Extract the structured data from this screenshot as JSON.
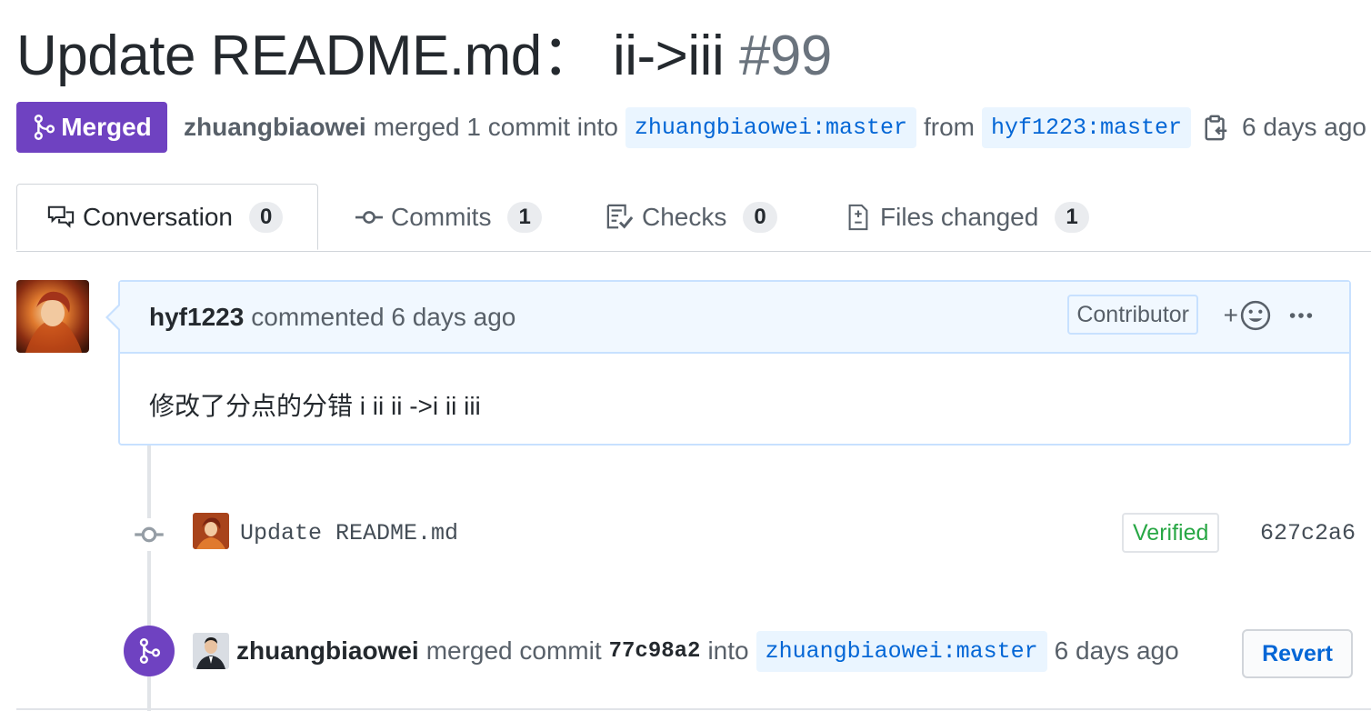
{
  "pr": {
    "title": "Update README.md： ii->iii",
    "number": "#99",
    "state": "Merged",
    "merger": "zhuangbiaowei",
    "merged_text": "merged 1 commit into",
    "base_ref": "zhuangbiaowei:master",
    "from_text": "from",
    "head_ref": "hyf1223:master",
    "time": "6 days ago"
  },
  "tabs": [
    {
      "label": "Conversation",
      "count": "0",
      "icon": "comment-discussion-icon"
    },
    {
      "label": "Commits",
      "count": "1",
      "icon": "git-commit-icon"
    },
    {
      "label": "Checks",
      "count": "0",
      "icon": "checklist-icon"
    },
    {
      "label": "Files changed",
      "count": "1",
      "icon": "file-diff-icon"
    }
  ],
  "comment": {
    "author": "hyf1223",
    "action": "commented 6 days ago",
    "role_badge": "Contributor",
    "reaction_plus": "+",
    "body": "修改了分点的分错 i ii ii ->i ii iii"
  },
  "commit": {
    "message": "Update README.md",
    "verified": "Verified",
    "sha": "627c2a6"
  },
  "merge_event": {
    "author": "zhuangbiaowei",
    "action": "merged commit",
    "sha": "77c98a2",
    "into": "into",
    "ref": "zhuangbiaowei:master",
    "time": "6 days ago",
    "revert_label": "Revert"
  },
  "colors": {
    "merged": "#6f42c1",
    "link": "#0366d6",
    "verified": "#28a745"
  }
}
